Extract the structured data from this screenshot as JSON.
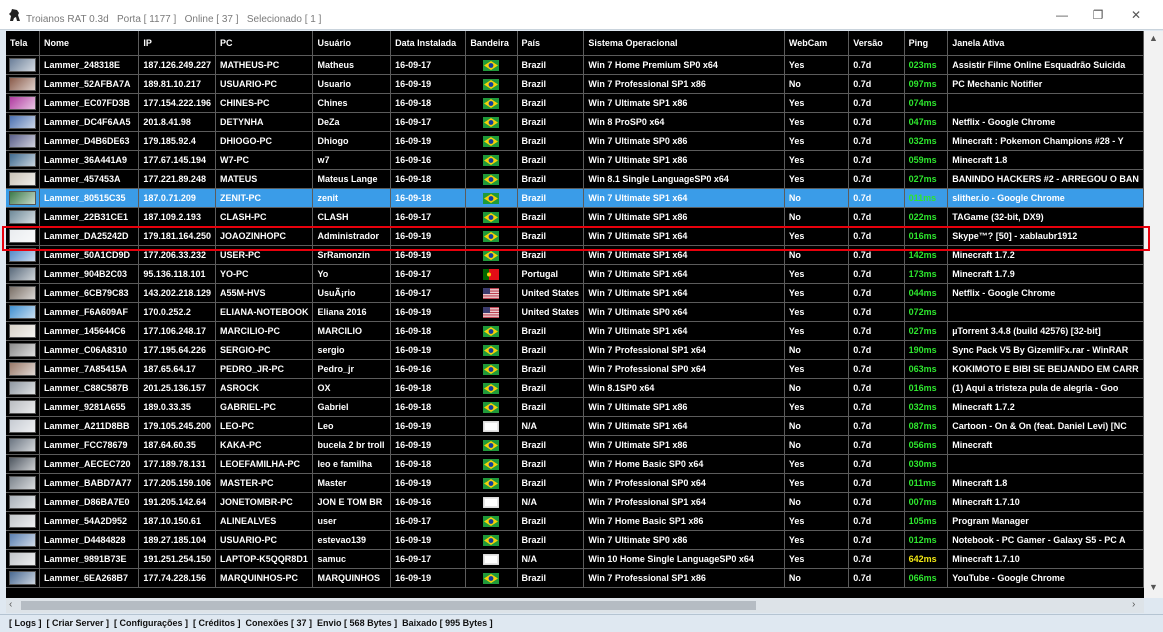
{
  "window": {
    "app_name": "Troianos RAT 0.3d",
    "port": "Porta [ 1177 ]",
    "online": "Online [ 37 ]",
    "selected": "Selecionado [ 1 ]"
  },
  "columns": [
    {
      "key": "tela",
      "label": "Tela"
    },
    {
      "key": "nome",
      "label": "Nome"
    },
    {
      "key": "ip",
      "label": "IP"
    },
    {
      "key": "pc",
      "label": "PC"
    },
    {
      "key": "usuario",
      "label": "Usuário"
    },
    {
      "key": "data",
      "label": "Data Instalada"
    },
    {
      "key": "bandeira",
      "label": "Bandeira"
    },
    {
      "key": "pais",
      "label": "País"
    },
    {
      "key": "so",
      "label": "Sistema Operacional"
    },
    {
      "key": "webcam",
      "label": "WebCam"
    },
    {
      "key": "versao",
      "label": "Versão"
    },
    {
      "key": "ping",
      "label": "Ping"
    },
    {
      "key": "janela",
      "label": "Janela Ativa"
    }
  ],
  "flag_colors": {
    "br": [
      "#1f9a3a",
      "#f5d20a",
      "#123e9c"
    ],
    "pt": [
      "#006600",
      "#e30d16"
    ],
    "us": [
      "#b22234",
      "#ffffff",
      "#3c3b6e"
    ],
    "na": [
      "#e8e8e8",
      "#ffffff"
    ]
  },
  "colors": {
    "ping_green": "#2ee62e",
    "ping_yellow": "#f0e614",
    "selected_row": "#3a9ce8",
    "highlight_box": "#e8000c"
  },
  "rows": [
    {
      "thumb": "#6b7f99",
      "nome": "Lammer_248318E",
      "ip": "187.126.249.227",
      "pc": "MATHEUS-PC",
      "usuario": "Matheus",
      "data": "16-09-17",
      "flag": "br",
      "pais": "Brazil",
      "so": "Win 7 Home Premium SP0 x64",
      "webcam": "Yes",
      "versao": "0.7d",
      "ping": "023ms",
      "ping_color": "#2ee62e",
      "janela": "Assistir Filme Online Esquadrão Suicida"
    },
    {
      "thumb": "#8a5b4a",
      "nome": "Lammer_52AFBA7A",
      "ip": "189.81.10.217",
      "pc": "USUARIO-PC",
      "usuario": "Usuario",
      "data": "16-09-19",
      "flag": "br",
      "pais": "Brazil",
      "so": "Win 7 Professional SP1 x86",
      "webcam": "No",
      "versao": "0.7d",
      "ping": "097ms",
      "ping_color": "#2ee62e",
      "janela": "PC Mechanic Notifier"
    },
    {
      "thumb": "#b03aa0",
      "nome": "Lammer_EC07FD3B",
      "ip": "177.154.222.196",
      "pc": "CHINES-PC",
      "usuario": "Chines",
      "data": "16-09-18",
      "flag": "br",
      "pais": "Brazil",
      "so": "Win 7 Ultimate SP1 x86",
      "webcam": "Yes",
      "versao": "0.7d",
      "ping": "074ms",
      "ping_color": "#2ee62e",
      "janela": ""
    },
    {
      "thumb": "#4a6fb0",
      "nome": "Lammer_DC4F6AA5",
      "ip": "201.8.41.98",
      "pc": "DETYNHA",
      "usuario": "DeZa",
      "data": "16-09-17",
      "flag": "br",
      "pais": "Brazil",
      "so": "Win 8 ProSP0 x64",
      "webcam": "Yes",
      "versao": "0.7d",
      "ping": "047ms",
      "ping_color": "#2ee62e",
      "janela": "Netflix - Google Chrome"
    },
    {
      "thumb": "#5a5f8a",
      "nome": "Lammer_D4B6DE63",
      "ip": "179.185.92.4",
      "pc": "DHIOGO-PC",
      "usuario": "Dhiogo",
      "data": "16-09-19",
      "flag": "br",
      "pais": "Brazil",
      "so": "Win 7 Ultimate SP0 x86",
      "webcam": "Yes",
      "versao": "0.7d",
      "ping": "032ms",
      "ping_color": "#2ee62e",
      "janela": "Minecraft : Pokemon Champions #28 - Y"
    },
    {
      "thumb": "#3f6a8f",
      "nome": "Lammer_36A441A9",
      "ip": "177.67.145.194",
      "pc": "W7-PC",
      "usuario": "w7",
      "data": "16-09-16",
      "flag": "br",
      "pais": "Brazil",
      "so": "Win 7 Ultimate SP1 x86",
      "webcam": "Yes",
      "versao": "0.7d",
      "ping": "059ms",
      "ping_color": "#2ee62e",
      "janela": "Minecraft 1.8"
    },
    {
      "thumb": "#c9c3b8",
      "nome": "Lammer_457453A",
      "ip": "177.221.89.248",
      "pc": "MATEUS",
      "usuario": "Mateus Lange",
      "data": "16-09-18",
      "flag": "br",
      "pais": "Brazil",
      "so": "Win 8.1 Single LanguageSP0 x64",
      "webcam": "Yes",
      "versao": "0.7d",
      "ping": "027ms",
      "ping_color": "#2ee62e",
      "janela": "BANINDO HACKERS #2 - ARREGOU O BAN"
    },
    {
      "thumb": "#3c7a4a",
      "nome": "Lammer_80515C35",
      "ip": "187.0.71.209",
      "pc": "ZENIT-PC",
      "usuario": "zenit",
      "data": "16-09-18",
      "flag": "br",
      "pais": "Brazil",
      "so": "Win 7 Ultimate SP1 x64",
      "webcam": "No",
      "versao": "0.7d",
      "ping": "011ms",
      "ping_color": "#2ee62e",
      "janela": "slither.io - Google Chrome",
      "selected": true
    },
    {
      "thumb": "#6f8a99",
      "nome": "Lammer_22B31CE1",
      "ip": "187.109.2.193",
      "pc": "CLASH-PC",
      "usuario": "CLASH",
      "data": "16-09-17",
      "flag": "br",
      "pais": "Brazil",
      "so": "Win 7 Ultimate SP1 x86",
      "webcam": "No",
      "versao": "0.7d",
      "ping": "022ms",
      "ping_color": "#2ee62e",
      "janela": "TAGame (32-bit, DX9)"
    },
    {
      "thumb": "#e9ecef",
      "nome": "Lammer_DA25242D",
      "ip": "179.181.164.250",
      "pc": "JOAOZINHOPC",
      "usuario": "Administrador",
      "data": "16-09-19",
      "flag": "br",
      "pais": "Brazil",
      "so": "Win 7 Ultimate SP1 x64",
      "webcam": "Yes",
      "versao": "0.7d",
      "ping": "016ms",
      "ping_color": "#2ee62e",
      "janela": "Skype™? [50] - xablaubr1912"
    },
    {
      "thumb": "#4f86c6",
      "nome": "Lammer_50A1CD9D",
      "ip": "177.206.33.232",
      "pc": "USER-PC",
      "usuario": "SrRamonzin",
      "data": "16-09-19",
      "flag": "br",
      "pais": "Brazil",
      "so": "Win 7 Ultimate SP1 x64",
      "webcam": "No",
      "versao": "0.7d",
      "ping": "142ms",
      "ping_color": "#2ee62e",
      "janela": "Minecraft 1.7.2"
    },
    {
      "thumb": "#5b6b7c",
      "nome": "Lammer_904B2C03",
      "ip": "95.136.118.101",
      "pc": "YO-PC",
      "usuario": "Yo",
      "data": "16-09-17",
      "flag": "pt",
      "pais": "Portugal",
      "so": "Win 7 Ultimate SP1 x64",
      "webcam": "Yes",
      "versao": "0.7d",
      "ping": "173ms",
      "ping_color": "#2ee62e",
      "janela": "Minecraft 1.7.9"
    },
    {
      "thumb": "#7a6f66",
      "nome": "Lammer_6CB79C83",
      "ip": "143.202.218.129",
      "pc": "A55M-HVS",
      "usuario": "UsuÃ¡rio",
      "data": "16-09-17",
      "flag": "us",
      "pais": "United States",
      "so": "Win 7 Ultimate SP1 x64",
      "webcam": "Yes",
      "versao": "0.7d",
      "ping": "044ms",
      "ping_color": "#2ee62e",
      "janela": "Netflix - Google Chrome"
    },
    {
      "thumb": "#3f8fd0",
      "nome": "Lammer_F6A609AF",
      "ip": "170.0.252.2",
      "pc": "ELIANA-NOTEBOOK",
      "usuario": "Eliana 2016",
      "data": "16-09-19",
      "flag": "us",
      "pais": "United States",
      "so": "Win 7 Ultimate SP0 x64",
      "webcam": "Yes",
      "versao": "0.7d",
      "ping": "072ms",
      "ping_color": "#2ee62e",
      "janela": ""
    },
    {
      "thumb": "#d8d2c8",
      "nome": "Lammer_145644C6",
      "ip": "177.106.248.17",
      "pc": "MARCILIO-PC",
      "usuario": "MARCILIO",
      "data": "16-09-18",
      "flag": "br",
      "pais": "Brazil",
      "so": "Win 7 Ultimate SP1 x64",
      "webcam": "Yes",
      "versao": "0.7d",
      "ping": "027ms",
      "ping_color": "#2ee62e",
      "janela": "µTorrent 3.4.8  (build 42576) [32-bit]"
    },
    {
      "thumb": "#8c8c8c",
      "nome": "Lammer_C06A8310",
      "ip": "177.195.64.226",
      "pc": "SERGIO-PC",
      "usuario": "sergio",
      "data": "16-09-19",
      "flag": "br",
      "pais": "Brazil",
      "so": "Win 7 Professional SP1 x64",
      "webcam": "No",
      "versao": "0.7d",
      "ping": "190ms",
      "ping_color": "#2ee62e",
      "janela": "Sync Pack V5 By GizemliFx.rar - WinRAR"
    },
    {
      "thumb": "#9a7a6a",
      "nome": "Lammer_7A85415A",
      "ip": "187.65.64.17",
      "pc": "PEDRO_JR-PC",
      "usuario": "Pedro_jr",
      "data": "16-09-16",
      "flag": "br",
      "pais": "Brazil",
      "so": "Win 7 Professional SP0 x64",
      "webcam": "Yes",
      "versao": "0.7d",
      "ping": "063ms",
      "ping_color": "#2ee62e",
      "janela": "KOKIMOTO E BIBI SE BEIJANDO EM CARR"
    },
    {
      "thumb": "#8f98a2",
      "nome": "Lammer_C88C587B",
      "ip": "201.25.136.157",
      "pc": "ASROCK",
      "usuario": "OX",
      "data": "16-09-18",
      "flag": "br",
      "pais": "Brazil",
      "so": "Win 8.1SP0 x64",
      "webcam": "No",
      "versao": "0.7d",
      "ping": "016ms",
      "ping_color": "#2ee62e",
      "janela": "(1) Aqui a tristeza pula de alegria - Goo"
    },
    {
      "thumb": "#b9bcc0",
      "nome": "Lammer_9281A655",
      "ip": "189.0.33.35",
      "pc": "GABRIEL-PC",
      "usuario": "Gabriel",
      "data": "16-09-18",
      "flag": "br",
      "pais": "Brazil",
      "so": "Win 7 Ultimate SP1 x86",
      "webcam": "Yes",
      "versao": "0.7d",
      "ping": "032ms",
      "ping_color": "#2ee62e",
      "janela": "Minecraft 1.7.2"
    },
    {
      "thumb": "#c6cbd2",
      "nome": "Lammer_A211D8BB",
      "ip": "179.105.245.200",
      "pc": "LEO-PC",
      "usuario": "Leo",
      "data": "16-09-19",
      "flag": "na",
      "pais": "N/A",
      "so": "Win 7 Ultimate SP1 x64",
      "webcam": "No",
      "versao": "0.7d",
      "ping": "087ms",
      "ping_color": "#2ee62e",
      "janela": "Cartoon - On & On (feat. Daniel Levi) [NC"
    },
    {
      "thumb": "#6c7682",
      "nome": "Lammer_FCC78679",
      "ip": "187.64.60.35",
      "pc": "KAKA-PC",
      "usuario": "bucela 2 br troll",
      "data": "16-09-19",
      "flag": "br",
      "pais": "Brazil",
      "so": "Win 7 Ultimate SP1 x86",
      "webcam": "No",
      "versao": "0.7d",
      "ping": "056ms",
      "ping_color": "#2ee62e",
      "janela": "Minecraft"
    },
    {
      "thumb": "#505862",
      "nome": "Lammer_AECEC720",
      "ip": "177.189.78.131",
      "pc": "LEOEFAMILHA-PC",
      "usuario": "leo e familha",
      "data": "16-09-18",
      "flag": "br",
      "pais": "Brazil",
      "so": "Win 7 Home Basic SP0 x64",
      "webcam": "Yes",
      "versao": "0.7d",
      "ping": "030ms",
      "ping_color": "#2ee62e",
      "janela": ""
    },
    {
      "thumb": "#7c848c",
      "nome": "Lammer_BABD7A77",
      "ip": "177.205.159.106",
      "pc": "MASTER-PC",
      "usuario": "Master",
      "data": "16-09-19",
      "flag": "br",
      "pais": "Brazil",
      "so": "Win 7 Professional SP0 x64",
      "webcam": "Yes",
      "versao": "0.7d",
      "ping": "011ms",
      "ping_color": "#2ee62e",
      "janela": "Minecraft 1.8"
    },
    {
      "thumb": "#a8b0b8",
      "nome": "Lammer_D86BA7E0",
      "ip": "191.205.142.64",
      "pc": "JONETOMBR-PC",
      "usuario": "JON E TOM BR",
      "data": "16-09-16",
      "flag": "na",
      "pais": "N/A",
      "so": "Win 7 Professional SP1 x64",
      "webcam": "No",
      "versao": "0.7d",
      "ping": "007ms",
      "ping_color": "#2ee62e",
      "janela": "Minecraft 1.7.10"
    },
    {
      "thumb": "#c2c6ca",
      "nome": "Lammer_54A2D952",
      "ip": "187.10.150.61",
      "pc": "ALINEALVES",
      "usuario": "user",
      "data": "16-09-17",
      "flag": "br",
      "pais": "Brazil",
      "so": "Win 7 Home Basic SP1 x86",
      "webcam": "Yes",
      "versao": "0.7d",
      "ping": "105ms",
      "ping_color": "#2ee62e",
      "janela": "Program Manager"
    },
    {
      "thumb": "#5a7fb0",
      "nome": "Lammer_D4484828",
      "ip": "189.27.185.104",
      "pc": "USUARIO-PC",
      "usuario": "estevao139",
      "data": "16-09-19",
      "flag": "br",
      "pais": "Brazil",
      "so": "Win 7 Ultimate SP0 x86",
      "webcam": "Yes",
      "versao": "0.7d",
      "ping": "012ms",
      "ping_color": "#2ee62e",
      "janela": "Notebook - PC Gamer - Galaxy S5 - PC A"
    },
    {
      "thumb": "#c0c4c8",
      "nome": "Lammer_9891B73E",
      "ip": "191.251.254.150",
      "pc": "LAPTOP-K5QQR8D1",
      "usuario": "samuc",
      "data": "16-09-17",
      "flag": "na",
      "pais": "N/A",
      "so": "Win 10 Home Single LanguageSP0 x64",
      "webcam": "Yes",
      "versao": "0.7d",
      "ping": "642ms",
      "ping_color": "#f0e614",
      "janela": "Minecraft 1.7.10"
    },
    {
      "thumb": "#4a6a92",
      "nome": "Lammer_6EA268B7",
      "ip": "177.74.228.156",
      "pc": "MARQUINHOS-PC",
      "usuario": "MARQUINHOS",
      "data": "16-09-19",
      "flag": "br",
      "pais": "Brazil",
      "so": "Win 7 Professional SP1 x86",
      "webcam": "No",
      "versao": "0.7d",
      "ping": "066ms",
      "ping_color": "#2ee62e",
      "janela": "YouTube - Google Chrome"
    }
  ],
  "status": "[ Logs ]  [ Criar Server ]  [ Configurações ]  [ Créditos ]  Conexões [ 37 ]  Envio [ 568 Bytes ]  Baixado [ 995 Bytes ]",
  "window_controls": {
    "minimize": "—",
    "maximize": "❐",
    "close": "✕"
  },
  "icons": {
    "app": "trojan-horse-icon"
  }
}
